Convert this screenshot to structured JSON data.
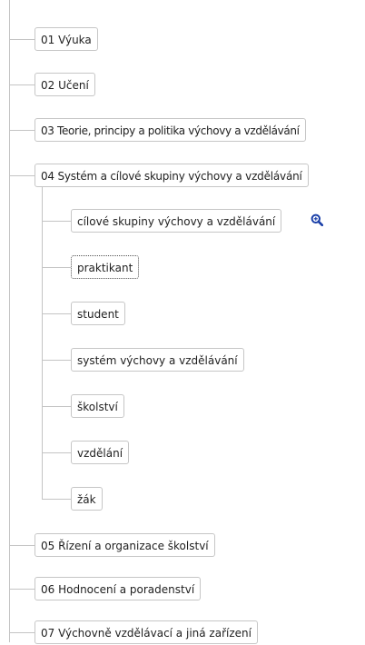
{
  "tree": {
    "nodes": [
      {
        "label": "01 Výuka"
      },
      {
        "label": "02 Učení"
      },
      {
        "label": "03 Teorie, principy a politika výchovy a vzdělávání"
      },
      {
        "label": "04 Systém a cílové skupiny výchovy a vzdělávání"
      },
      {
        "label": "05 Řízení a organizace školství"
      },
      {
        "label": "06 Hodnocení a poradenství"
      },
      {
        "label": "07 Výchovně vzdělávací a jiná zařízení"
      }
    ],
    "children": [
      {
        "label": "cílové skupiny výchovy a vzdělávání"
      },
      {
        "label": "praktikant"
      },
      {
        "label": "student"
      },
      {
        "label": "systém výchovy a vzdělávání"
      },
      {
        "label": "školství"
      },
      {
        "label": "vzdělání"
      },
      {
        "label": "žák"
      }
    ]
  },
  "icons": {
    "zoom": "magnifier-zoom-icon"
  },
  "colors": {
    "connector": "#c4c4c4",
    "node_border": "#c6c6c6",
    "zoom_icon": "#1a3fa8"
  }
}
